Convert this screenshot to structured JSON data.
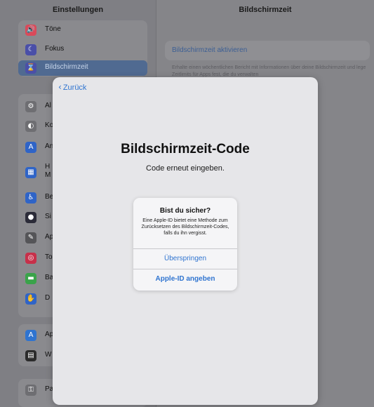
{
  "sidebar": {
    "title": "Einstellungen",
    "items_top": [
      {
        "label": "Töne",
        "icon": "speaker-icon",
        "color": "#d94a5a",
        "glyph": "🔊"
      },
      {
        "label": "Fokus",
        "icon": "moon-icon",
        "color": "#4a4fa8",
        "glyph": "☾"
      },
      {
        "label": "Bildschirmzeit",
        "icon": "hourglass-icon",
        "color": "#4a4fa8",
        "glyph": "⌛"
      }
    ],
    "items_mid": [
      {
        "label": "Al",
        "icon": "gear-icon",
        "color": "#6e6e72",
        "glyph": "⚙"
      },
      {
        "label": "Ko",
        "icon": "toggles-icon",
        "color": "#6e6e72",
        "glyph": "◐"
      },
      {
        "label": "An",
        "icon": "text-size-icon",
        "color": "#2f64c7",
        "glyph": "A"
      },
      {
        "label": "H",
        "label2": "M",
        "icon": "grid-icon",
        "color": "#2f64c7",
        "glyph": "▦"
      },
      {
        "label": "Be",
        "icon": "accessibility-icon",
        "color": "#2f64c7",
        "glyph": "♿"
      },
      {
        "label": "Si",
        "icon": "siri-icon",
        "color": "#2b2b38",
        "glyph": "●"
      },
      {
        "label": "Ap",
        "icon": "pencil-icon",
        "color": "#555558",
        "glyph": "✎"
      },
      {
        "label": "To",
        "icon": "fingerprint-icon",
        "color": "#c7304a",
        "glyph": "◎"
      },
      {
        "label": "Ba",
        "icon": "battery-icon",
        "color": "#3aa34a",
        "glyph": "▬"
      },
      {
        "label": "D",
        "icon": "hand-icon",
        "color": "#2f64c7",
        "glyph": "✋"
      }
    ],
    "items_bottom": [
      {
        "label": "Ap",
        "icon": "app-store-icon",
        "color": "#2f74d0",
        "glyph": "A"
      },
      {
        "label": "W",
        "icon": "wallet-icon",
        "color": "#2b2b2b",
        "glyph": "▤"
      }
    ],
    "items_last": [
      {
        "label": "Pa",
        "icon": "key-icon",
        "color": "#6e6e72",
        "glyph": "⚿"
      }
    ]
  },
  "detail": {
    "title": "Bildschirmzeit",
    "activate_label": "Bildschirmzeit aktivieren",
    "footnote": "Erhalte einen wöchentlichen Bericht mit Informationen über deine Bildschirmzeit und lege Zeitlimits für Apps fest, die du verwalten"
  },
  "sheet": {
    "back_label": "Zurück",
    "title": "Bildschirmzeit-Code",
    "subtitle": "Code erneut eingeben."
  },
  "alert": {
    "title": "Bist du sicher?",
    "message": "Eine Apple-ID bietet eine Methode zum Zurücksetzen des Bildschirmzeit-Codes, falls du ihn vergisst.",
    "skip_label": "Überspringen",
    "apple_id_label": "Apple-ID angeben"
  },
  "colors": {
    "accent": "#2f74d0",
    "sheet_background": "#e6e6e9",
    "dimmed_background": "#858589"
  }
}
